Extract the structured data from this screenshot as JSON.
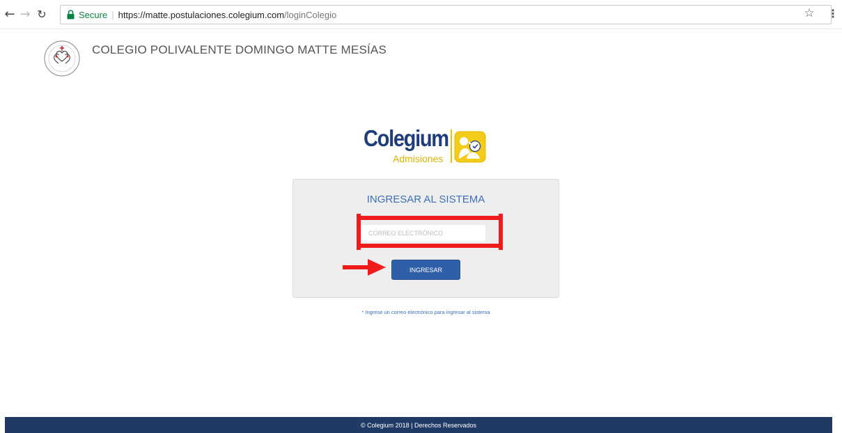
{
  "browser": {
    "secure_label": "Secure",
    "url_host": "https://matte.postulaciones.colegium.com",
    "url_path": "/loginColegio",
    "icons": {
      "back": "back-arrow-icon",
      "forward": "forward-arrow-icon",
      "reload": "reload-icon",
      "lock": "lock-icon",
      "bookmark": "star-icon",
      "menu": "kebab-menu-icon"
    }
  },
  "header": {
    "school_name": "COLEGIO POLIVALENTE DOMINGO MATTE MESÍAS",
    "logo_text": "COLEGIO DOMINGO MATTE MESÍAS"
  },
  "brand": {
    "name": "Colegium",
    "subtitle": "Admisiones",
    "colors": {
      "primary": "#1f3d7a",
      "accent": "#e6c200"
    }
  },
  "login": {
    "title": "INGRESAR AL SISTEMA",
    "email_placeholder": "CORREO ELECTRÓNICO",
    "email_value": "",
    "submit_label": "INGRESAR",
    "helper_text": "* Ingrese un correo electrónico para ingresar al sistema"
  },
  "annotations": {
    "color": "#ee1c1c"
  },
  "footer": {
    "text": "© Colegium 2018 | Derechos Reservados"
  }
}
